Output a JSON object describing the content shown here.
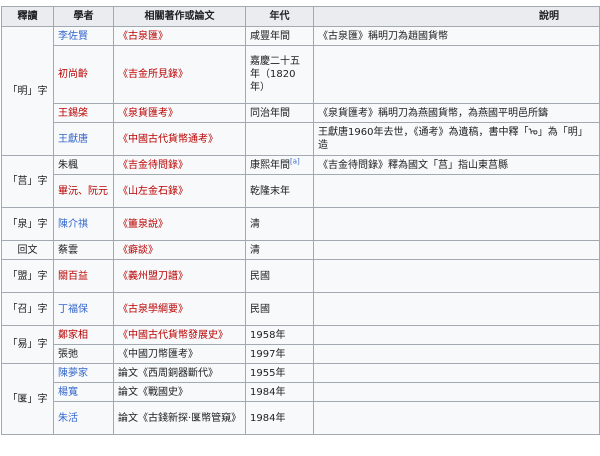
{
  "caption": "",
  "headers": [
    "釋讀",
    "學者",
    "相關著作或論文",
    "年代",
    "說明"
  ],
  "colors": {
    "link": "#3366cc",
    "redlink": "#ba0000",
    "header_bg": "#eaecf0",
    "border": "#a2a9b1"
  },
  "groups": [
    {
      "reading": "「明」字",
      "rows": [
        {
          "scholar": "李佐賢",
          "scholar_link": "blue",
          "work": "《古泉匯》",
          "work_link": "red",
          "era": "咸豐年間",
          "note": "《古泉匯》稱明刀為趙國貨幣"
        },
        {
          "scholar": "初尚齡",
          "scholar_link": "red",
          "work": "《吉金所見錄》",
          "work_link": "red",
          "era": "嘉慶二十五年（1820年）",
          "note": ""
        },
        {
          "scholar": "王錫棨",
          "scholar_link": "red",
          "work": "《泉貨匯考》",
          "work_link": "red",
          "era": "同治年間",
          "note": "《泉貨匯考》稱明刀為燕國貨幣，為燕國平明邑所鑄"
        },
        {
          "scholar": "王獻唐",
          "scholar_link": "blue",
          "work": "《中國古代貨幣通考》",
          "work_link": "red",
          "era": "",
          "note": "王獻唐1960年去世，《通考》為遺稿，書中釋「ᠣ」為「明」造"
        }
      ]
    },
    {
      "reading": "「莒」字",
      "rows": [
        {
          "scholar": "朱楓",
          "scholar_link": "dark",
          "work": "《吉金待問錄》",
          "work_link": "red",
          "era": "康熙年間",
          "era_sup": "[a]",
          "note": "《吉金待問錄》釋為國文「莒」指山東莒縣"
        },
        {
          "scholar": "畢沅、阮元",
          "scholar_link": "red",
          "work": "《山左金石錄》",
          "work_link": "red",
          "era": "乾隆末年",
          "note": ""
        }
      ]
    },
    {
      "reading": "「泉」字",
      "rows": [
        {
          "scholar": "陳介祺",
          "scholar_link": "blue",
          "work": "《簠泉說》",
          "work_link": "red",
          "era": "清",
          "note": ""
        }
      ]
    },
    {
      "reading": "回文",
      "rows": [
        {
          "scholar": "蔡雲",
          "scholar_link": "dark",
          "work": "《癖談》",
          "work_link": "red",
          "era": "清",
          "note": ""
        }
      ]
    },
    {
      "reading": "「盟」字",
      "rows": [
        {
          "scholar": "關百益",
          "scholar_link": "red",
          "work": "《義州盟刀譜》",
          "work_link": "red",
          "era": "民國",
          "note": ""
        }
      ]
    },
    {
      "reading": "「召」字",
      "rows": [
        {
          "scholar": "丁福保",
          "scholar_link": "blue",
          "work": "《古泉學綱要》",
          "work_link": "red",
          "era": "民國",
          "note": ""
        }
      ]
    },
    {
      "reading": "「易」字",
      "rows": [
        {
          "scholar": "鄭家相",
          "scholar_link": "red",
          "work": "《中國古代貨幣發展史》",
          "work_link": "red",
          "era": "1958年",
          "note": ""
        },
        {
          "scholar": "張弛",
          "scholar_link": "dark",
          "work": "《中國刀幣匯考》",
          "work_link": "dark",
          "era": "1997年",
          "note": ""
        }
      ]
    },
    {
      "reading": "「匽」字",
      "rows": [
        {
          "scholar": "陳夢家",
          "scholar_link": "blue",
          "work": "論文《西周銅器斷代》",
          "work_link": "dark",
          "era": "1955年",
          "note": ""
        },
        {
          "scholar": "楊寬",
          "scholar_link": "blue",
          "work": "論文《戰國史》",
          "work_link": "dark",
          "era": "1984年",
          "note": ""
        },
        {
          "scholar": "朱活",
          "scholar_link": "blue",
          "work": "論文《古錢新探·匽幣管窺》",
          "work_link": "dark",
          "era": "1984年",
          "note": ""
        }
      ]
    }
  ]
}
